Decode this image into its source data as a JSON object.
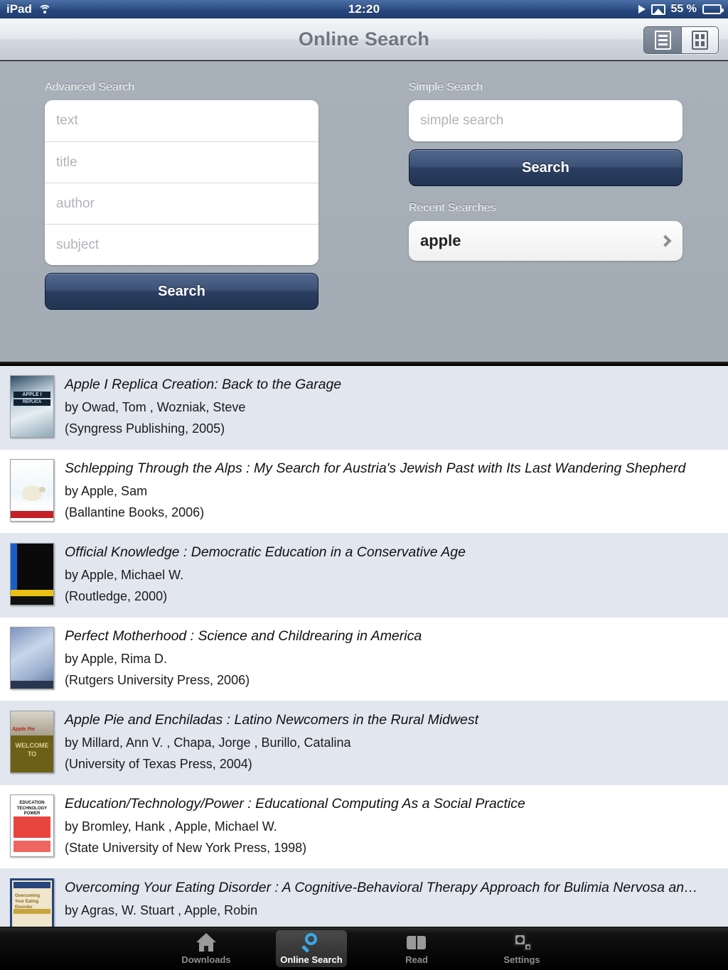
{
  "status_bar": {
    "device": "iPad",
    "wifi_icon": "wifi-icon",
    "time": "12:20",
    "play_icon": "play-icon",
    "airplay_icon": "airplay-icon",
    "battery_percent": "55 %",
    "battery_level": 55
  },
  "nav": {
    "title": "Online Search",
    "view_list_icon": "list-view-icon",
    "view_grid_icon": "grid-view-icon",
    "selected_view": "list"
  },
  "advanced_search": {
    "label": "Advanced Search",
    "fields": [
      {
        "name": "text",
        "placeholder": "text",
        "value": ""
      },
      {
        "name": "title",
        "placeholder": "title",
        "value": ""
      },
      {
        "name": "author",
        "placeholder": "author",
        "value": ""
      },
      {
        "name": "subject",
        "placeholder": "subject",
        "value": ""
      }
    ],
    "search_button": "Search"
  },
  "simple_search": {
    "label": "Simple Search",
    "placeholder": "simple search",
    "value": "",
    "search_button": "Search",
    "recent_label": "Recent Searches",
    "recent": [
      {
        "query": "apple",
        "chevron_icon": "chevron-right-icon"
      }
    ]
  },
  "results": [
    {
      "title": "Apple I Replica Creation: Back to the Garage",
      "author": "by Owad, Tom , Wozniak, Steve",
      "publisher": "(Syngress Publishing, 2005)",
      "cover_line1": "APPLE I",
      "cover_line2": "REPLICA CREATION"
    },
    {
      "title": "Schlepping Through the Alps : My Search for Austria's Jewish Past with Its Last Wandering Shepherd",
      "author": "by Apple, Sam",
      "publisher": "(Ballantine Books, 2006)",
      "cover_line1": "",
      "cover_line2": ""
    },
    {
      "title": "Official Knowledge : Democratic Education in a Conservative Age",
      "author": "by Apple, Michael W.",
      "publisher": "(Routledge, 2000)",
      "cover_line1": "",
      "cover_line2": ""
    },
    {
      "title": "Perfect Motherhood : Science and Childrearing in America",
      "author": "by Apple, Rima D.",
      "publisher": "(Rutgers University Press, 2006)",
      "cover_line1": "",
      "cover_line2": ""
    },
    {
      "title": "Apple Pie and Enchiladas : Latino Newcomers in the Rural Midwest",
      "author": "by Millard, Ann V. , Chapa, Jorge , Burillo, Catalina",
      "publisher": "(University of Texas Press, 2004)",
      "cover_line1": "Apple Pie",
      "cover_line2": "WELCOME TO"
    },
    {
      "title": "Education/Technology/Power : Educational Computing As a Social Practice",
      "author": "by Bromley, Hank , Apple, Michael W.",
      "publisher": "(State University of New York Press, 1998)",
      "cover_line1": "EDUCATION TECHNOLOGY POWER",
      "cover_line2": ""
    },
    {
      "title": "Overcoming Your Eating Disorder : A Cognitive-Behavioral Therapy Approach for Bulimia Nervosa an…",
      "author": "by Agras, W. Stuart , Apple, Robin",
      "publisher": "",
      "cover_line1": "Overcoming Your Eating Disorder",
      "cover_line2": ""
    }
  ],
  "tabbar": {
    "tabs": [
      {
        "label": "Downloads",
        "icon": "home-icon",
        "selected": false
      },
      {
        "label": "Online Search",
        "icon": "search-icon",
        "selected": true
      },
      {
        "label": "Read",
        "icon": "book-icon",
        "selected": false
      },
      {
        "label": "Settings",
        "icon": "gear-icon",
        "selected": false
      }
    ]
  }
}
